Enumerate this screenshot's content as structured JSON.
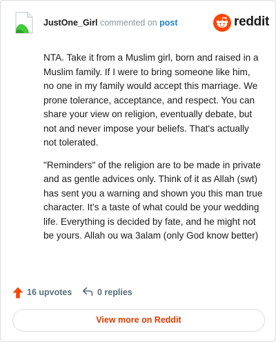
{
  "header": {
    "username": "JustOne_Girl",
    "action_text": "commented on",
    "post_link": "post",
    "brand_name": "reddit"
  },
  "comment": {
    "paragraphs": [
      "NTA. Take it from a Muslim girl, born and raised in a Muslim family. If I were to bring someone like him, no one in my family would accept this marriage. We prone tolerance, acceptance, and respect. You can share your view on religion, eventually debate, but not and never impose your beliefs. That's actually not tolerated.",
      "\"Reminders\" of the religion are to be made in private and as gentle advices only. Think of it as Allah (swt) has sent you a warning and shown you this man true character. It's a taste of what could be your wedding life. Everything is decided by fate, and he might not be yours. Allah ou wa 3alam (only God know better)"
    ]
  },
  "footer": {
    "upvotes_label": "16 upvotes",
    "replies_label": "0 replies",
    "view_more_label": "View more on Reddit"
  },
  "icons": {
    "avatar": "document-icon",
    "brand": "reddit-snoo-icon",
    "upvote": "upvote-arrow-icon",
    "reply": "reply-arrow-icon"
  },
  "colors": {
    "brand_orange": "#ff4500",
    "link_blue": "#1f7fd1",
    "view_more_text": "#d93a00",
    "meta_gray": "#576f76",
    "avatar_green": "#46c93a"
  }
}
